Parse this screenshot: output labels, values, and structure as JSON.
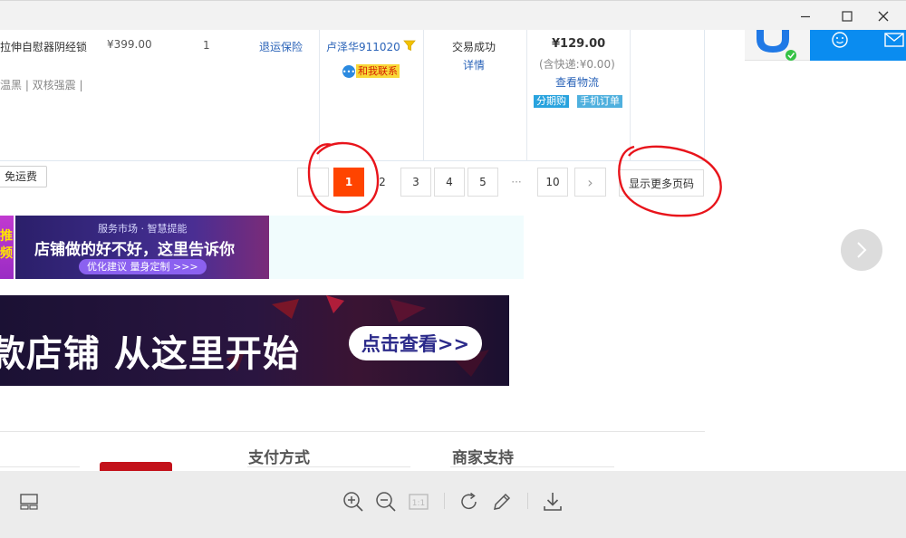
{
  "window": {
    "minimize": "—",
    "maximize": "□",
    "close": "×"
  },
  "order": {
    "product_title": "拉伸自慰器阴经锁",
    "product_specs": "温黑 | 双核强震 |",
    "unit_price": "¥399.00",
    "quantity": "1",
    "service": "退运保险",
    "seller": "卢泽华911020",
    "contact": "和我联系",
    "status": "交易成功",
    "details": "详情",
    "total": "¥129.00",
    "shipping": "(含快递:¥0.00)",
    "logistics": "查看物流",
    "tag_installment": "分期购",
    "tag_mobile": "手机订单"
  },
  "filter": {
    "free_shipping": "免运费"
  },
  "pagination": {
    "pages": [
      "1",
      "2",
      "3",
      "4",
      "5"
    ],
    "ellipsis": "···",
    "last": "10",
    "next": "›",
    "more": "显示更多页码"
  },
  "banner1": {
    "left_text": "推\n频",
    "small": "服务市场 · 智慧提能",
    "headline": "店铺做的好不好，这里告诉你",
    "button": "优化建议  量身定制 >>>"
  },
  "banner2": {
    "headline": "款店铺 从这里开始",
    "button": "点击查看>>"
  },
  "footer": {
    "payment": "支付方式",
    "merchant": "商家支持"
  },
  "colors": {
    "accent": "#ff4400",
    "link": "#2a63b8",
    "annotation": "#e8141b"
  }
}
